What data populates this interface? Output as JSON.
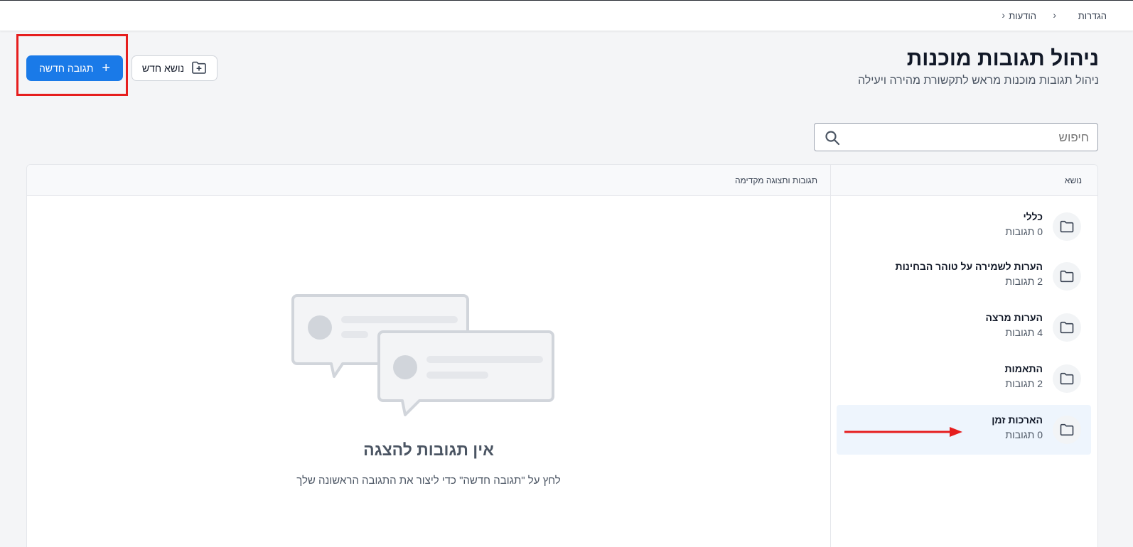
{
  "breadcrumb": {
    "items": [
      "הגדרות",
      "הודעות"
    ]
  },
  "header": {
    "title": "ניהול תגובות מוכנות",
    "subtitle": "ניהול תגובות מוכנות מראש לתקשורת מהירה ויעילה"
  },
  "actions": {
    "new_response": "תגובה חדשה",
    "new_topic": "נושא חדש"
  },
  "search": {
    "placeholder": "חיפוש"
  },
  "table": {
    "col_topic": "נושא",
    "col_responses": "תגובות ותצוגה מקדימה"
  },
  "topics": [
    {
      "name": "כללי",
      "count": "0 תגובות"
    },
    {
      "name": "הערות לשמירה על טוהר הבחינות",
      "count": "2 תגובות"
    },
    {
      "name": "הערות מרצה",
      "count": "4 תגובות"
    },
    {
      "name": "התאמות",
      "count": "2 תגובות"
    },
    {
      "name": "הארכות זמן",
      "count": "0 תגובות"
    }
  ],
  "empty_state": {
    "title": "אין תגובות להצגה",
    "description": "לחץ על \"תגובה חדשה\" כדי ליצור את התגובה הראשונה שלך"
  },
  "colors": {
    "primary": "#1a7ae8",
    "selected_row": "#eef5fd",
    "annotation": "#e61e1e"
  }
}
